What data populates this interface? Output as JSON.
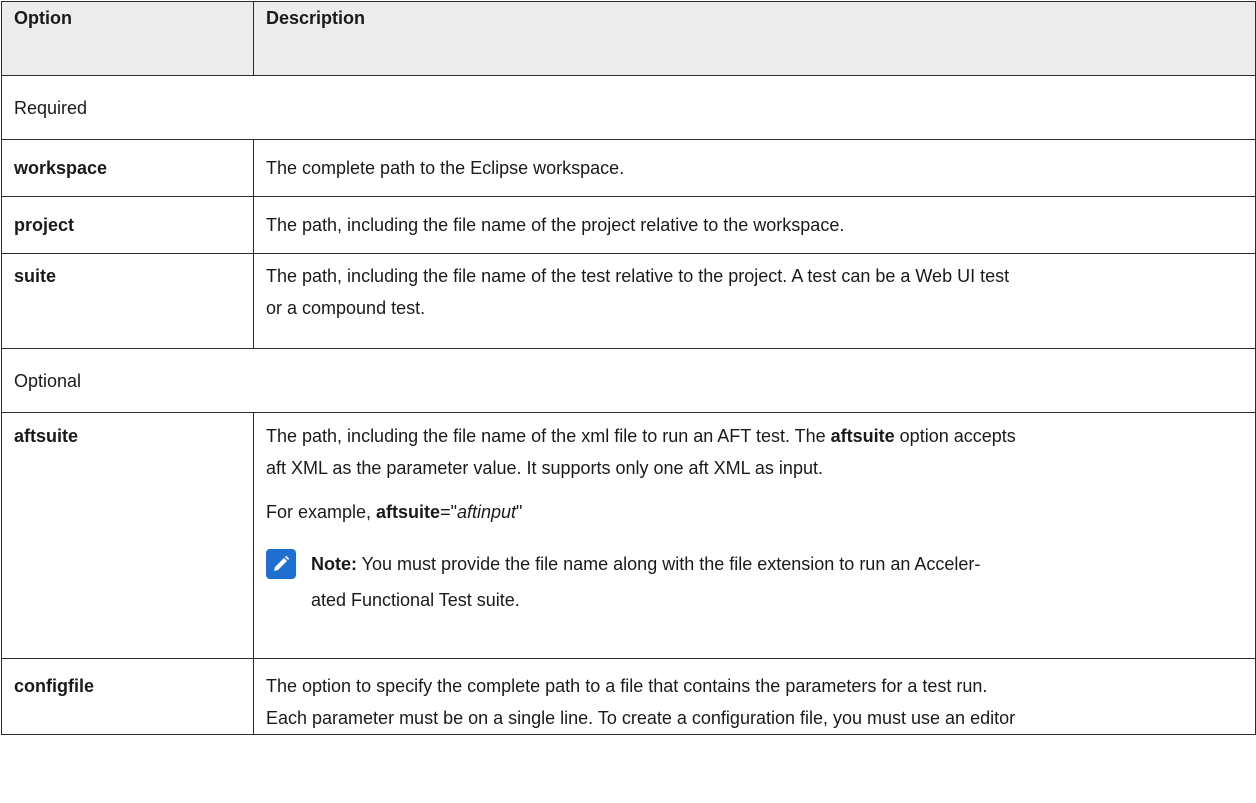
{
  "table": {
    "headers": {
      "option": "Option",
      "description": "Description"
    },
    "section_required": "Required",
    "section_optional": "Optional",
    "rows": {
      "workspace": {
        "option": "workspace",
        "description": "The complete path to the Eclipse workspace."
      },
      "project": {
        "option": "project",
        "description": "The path, including the file name of the project relative to the workspace."
      },
      "suite": {
        "option": "suite",
        "description_line1": "The path, including the file name of the test relative to the project. A test can be a Web UI test",
        "description_line2": "or a compound test."
      },
      "aftsuite": {
        "option": "aftsuite",
        "desc_part1": "The path, including the file name of the xml file to run an AFT test. The ",
        "desc_kw": "aftsuite",
        "desc_part2": " option accepts",
        "desc_line2": "aft XML as the parameter value. It supports only one aft XML as input.",
        "example_prefix": "For example, ",
        "example_kw": "aftsuite",
        "example_eq": "=\"",
        "example_value": "aftinput",
        "example_close": "\"",
        "note_label": "Note:",
        "note_line1": " You must provide the file name along with the file extension to run an Acceler-",
        "note_line2": "ated Functional Test suite.",
        "note_icon": "pencil-icon",
        "note_icon_color": "#1f6fd1"
      },
      "configfile": {
        "option": "configfile",
        "description_line1": "The option to specify the complete path to a file that contains the parameters for a test run.",
        "description_line2": "Each parameter must be on a single line. To create a configuration file, you must use an editor"
      }
    }
  }
}
